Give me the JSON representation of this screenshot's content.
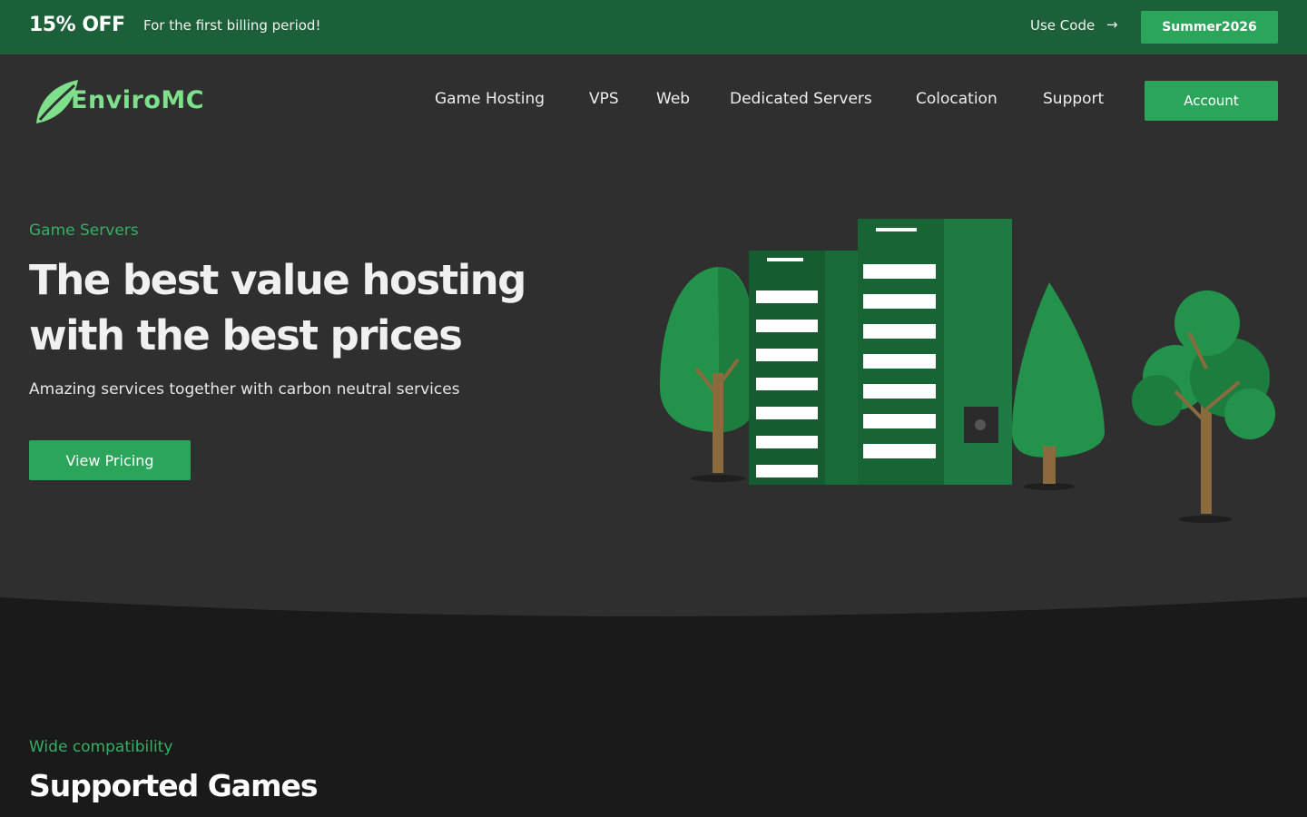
{
  "promo": {
    "discount": "15% OFF",
    "text": "For the first billing period!",
    "use_code_label": "Use Code",
    "arrow_icon": "arrow-right-icon",
    "code": "Summer2026"
  },
  "brand": {
    "name": "EnviroMC",
    "logo_icon": "leaf-icon"
  },
  "nav": {
    "items": [
      "Game Hosting",
      "VPS",
      "Web",
      "Dedicated Servers",
      "Colocation",
      "Support"
    ],
    "account_label": "Account"
  },
  "hero": {
    "eyebrow": "Game Servers",
    "title_line1": "The best value hosting",
    "title_line2": "with the best prices",
    "subtitle": "Amazing services together with carbon neutral services",
    "cta": "View Pricing",
    "illustration": "servers-and-trees-illustration"
  },
  "games": {
    "eyebrow": "Wide compatibility",
    "title": "Supported Games"
  },
  "colors": {
    "promo_bg": "#1b6038",
    "accent": "#2aa55a",
    "accent_text": "#34b063",
    "hero_bg": "#2f2f2f",
    "section_bg": "#1a1a1a"
  }
}
